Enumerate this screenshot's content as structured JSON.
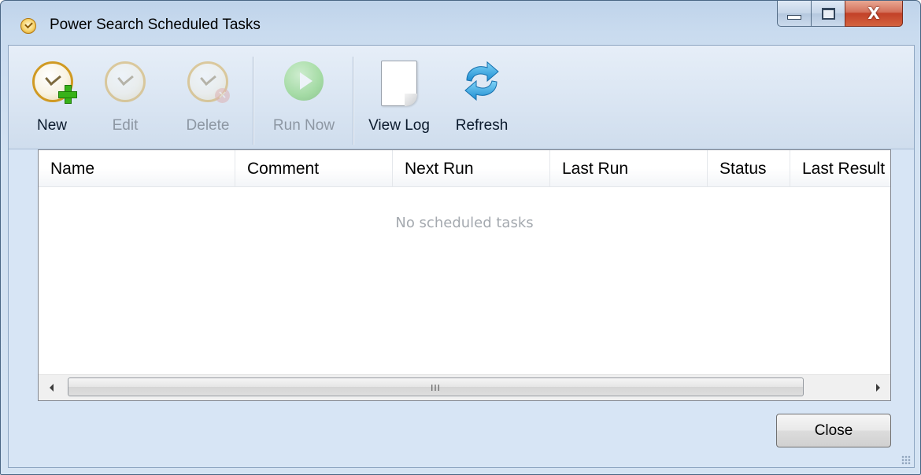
{
  "window": {
    "title": "Power Search Scheduled Tasks",
    "caption_buttons": {
      "minimize_icon": "minimize-icon",
      "maximize_icon": "maximize-icon",
      "close_glyph": "X"
    }
  },
  "toolbar": {
    "buttons": [
      {
        "label": "New",
        "icon": "clock-add-icon",
        "enabled": true
      },
      {
        "label": "Edit",
        "icon": "clock-edit-icon",
        "enabled": false
      },
      {
        "label": "Delete",
        "icon": "clock-delete-icon",
        "enabled": false
      },
      {
        "label": "Run Now",
        "icon": "play-icon",
        "enabled": false
      },
      {
        "label": "View Log",
        "icon": "document-icon",
        "enabled": true
      },
      {
        "label": "Refresh",
        "icon": "refresh-icon",
        "enabled": true
      }
    ]
  },
  "task_list": {
    "columns": [
      "Name",
      "Comment",
      "Next Run",
      "Last Run",
      "Status",
      "Last Result"
    ],
    "rows": [],
    "empty_message": "No scheduled tasks",
    "scrollbar_grip": "III"
  },
  "footer": {
    "close_label": "Close"
  },
  "colors": {
    "accent": "#d09a23",
    "window_frame": "#4a6684",
    "client_bg": "#d7e5f5"
  }
}
